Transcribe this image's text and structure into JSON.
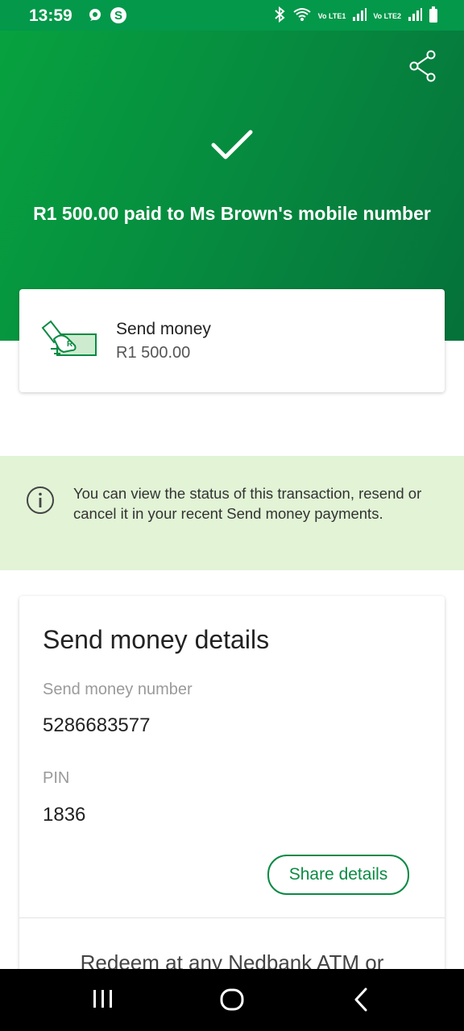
{
  "status_bar": {
    "time": "13:59",
    "notification_icons": [
      "chat-icon",
      "dollar-icon"
    ],
    "right_icons": [
      "bluetooth-icon",
      "wifi-icon",
      "signal-icon",
      "battery-icon"
    ],
    "sim1_label": "Vo LTE1",
    "sim2_label": "Vo LTE2"
  },
  "header": {
    "share_icon": "share-icon",
    "success_icon": "checkmark-icon",
    "title": "R1 500.00 paid to Ms Brown's mobile number",
    "background_color": "#07a23f"
  },
  "summary": {
    "icon": "send-money-icon",
    "label": "Send money",
    "amount": "R1 500.00"
  },
  "info": {
    "icon": "info-icon",
    "text": "You can view the status of this transaction, resend or cancel it in your recent Send money payments.",
    "background_color": "#e2f3d6"
  },
  "details": {
    "title": "Send money details",
    "number_label": "Send money number",
    "number_value": "5286683577",
    "pin_label": "PIN",
    "pin_value": "1836",
    "share_button": "Share details",
    "redeem_text": "Redeem at any Nedbank ATM or"
  },
  "nav_bar": {
    "recents": "recents-icon",
    "home": "home-icon",
    "back": "back-icon"
  },
  "accent_color": "#0a8a43"
}
